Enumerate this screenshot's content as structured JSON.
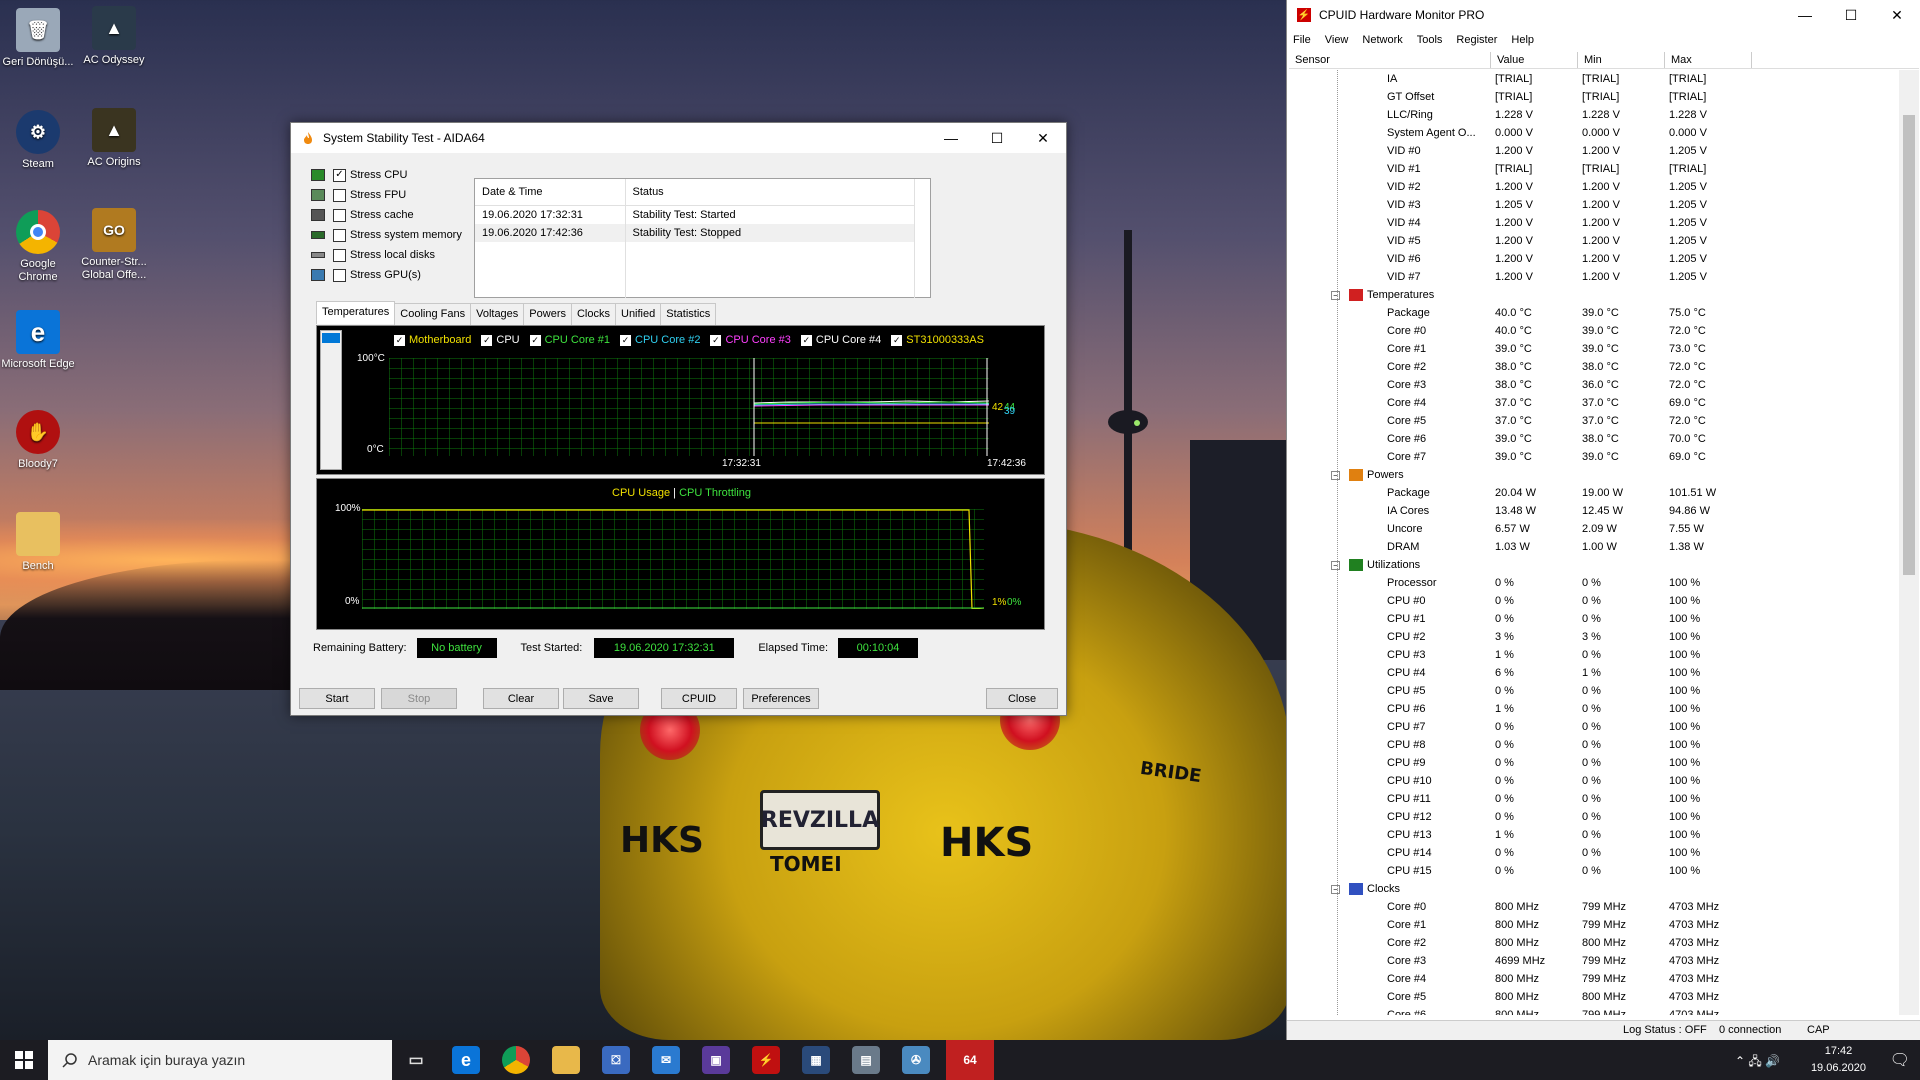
{
  "desktop": {
    "icons": [
      {
        "label": "Geri Dönüşü...",
        "icon": "recycle-bin-icon",
        "color": "#9aa8b8"
      },
      {
        "label": "AC Odyssey",
        "icon": "ac-odyssey-icon",
        "color": "#2a3a4a"
      },
      {
        "label": "Steam",
        "icon": "steam-icon",
        "color": "#1b3a6e"
      },
      {
        "label": "AC Origins",
        "icon": "ac-origins-icon",
        "color": "#3a3420"
      },
      {
        "label": "Google Chrome",
        "icon": "chrome-icon",
        "color": "#db4437"
      },
      {
        "label": "Counter-Str... Global Offe...",
        "icon": "csgo-icon",
        "color": "#b07a20"
      },
      {
        "label": "Microsoft Edge",
        "icon": "edge-icon",
        "color": "#0a74d8"
      },
      {
        "label": "Bloody7",
        "icon": "bloody7-icon",
        "color": "#b01010"
      },
      {
        "label": "Bench",
        "icon": "folder-icon",
        "color": "#e8c060"
      }
    ]
  },
  "aida": {
    "title": "System Stability Test - AIDA64",
    "stress": [
      {
        "label": "Stress CPU",
        "checked": "✓"
      },
      {
        "label": "Stress FPU",
        "checked": ""
      },
      {
        "label": "Stress cache",
        "checked": ""
      },
      {
        "label": "Stress system memory",
        "checked": ""
      },
      {
        "label": "Stress local disks",
        "checked": ""
      },
      {
        "label": "Stress GPU(s)",
        "checked": ""
      }
    ],
    "log": {
      "headers": [
        "Date & Time",
        "Status"
      ],
      "rows": [
        [
          "19.06.2020 17:32:31",
          "Stability Test: Started"
        ],
        [
          "19.06.2020 17:42:36",
          "Stability Test: Stopped"
        ]
      ]
    },
    "tabs": [
      "Temperatures",
      "Cooling Fans",
      "Voltages",
      "Powers",
      "Clocks",
      "Unified",
      "Statistics"
    ],
    "temp_graph": {
      "legend": [
        {
          "label": "Motherboard",
          "color": "#f0e000"
        },
        {
          "label": "CPU",
          "color": "#ffffff"
        },
        {
          "label": "CPU Core #1",
          "color": "#3ee23e"
        },
        {
          "label": "CPU Core #2",
          "color": "#30d0f0"
        },
        {
          "label": "CPU Core #3",
          "color": "#ff40ff"
        },
        {
          "label": "CPU Core #4",
          "color": "#ffffff"
        },
        {
          "label": "ST31000333AS",
          "color": "#f0e000"
        }
      ],
      "y_top": "100",
      "y_top_unit": "°C",
      "y_bottom": "0",
      "y_bottom_unit": "°C",
      "t_start": "17:32:31",
      "t_end": "17:42:36",
      "end_values_a": "42",
      "end_values_b": "44",
      "end_values_c": "39"
    },
    "cpu_graph": {
      "title_usage": "CPU Usage",
      "separator": "|",
      "title_throttle": "CPU Throttling",
      "y_top": "100%",
      "y_bottom": "0%",
      "end_usage": "1%",
      "end_throttle": "0%"
    },
    "info": {
      "battery_label": "Remaining Battery:",
      "battery_value": "No battery",
      "started_label": "Test Started:",
      "started_value": "19.06.2020 17:32:31",
      "elapsed_label": "Elapsed Time:",
      "elapsed_value": "00:10:04"
    },
    "buttons": {
      "start": "Start",
      "stop": "Stop",
      "clear": "Clear",
      "save": "Save",
      "cpuid": "CPUID",
      "preferences": "Preferences",
      "close": "Close"
    }
  },
  "hwm": {
    "title": "CPUID Hardware Monitor PRO",
    "menu": [
      "File",
      "View",
      "Network",
      "Tools",
      "Register",
      "Help"
    ],
    "columns": [
      "Sensor",
      "Value",
      "Min",
      "Max"
    ],
    "rows": [
      {
        "type": "item",
        "n": "IA",
        "v": "[TRIAL]",
        "mi": "[TRIAL]",
        "ma": "[TRIAL]"
      },
      {
        "type": "item",
        "n": "GT Offset",
        "v": "[TRIAL]",
        "mi": "[TRIAL]",
        "ma": "[TRIAL]"
      },
      {
        "type": "item",
        "n": "LLC/Ring",
        "v": "1.228 V",
        "mi": "1.228 V",
        "ma": "1.228 V"
      },
      {
        "type": "item",
        "n": "System Agent O...",
        "v": "0.000 V",
        "mi": "0.000 V",
        "ma": "0.000 V"
      },
      {
        "type": "item",
        "n": "VID #0",
        "v": "1.200 V",
        "mi": "1.200 V",
        "ma": "1.205 V"
      },
      {
        "type": "item",
        "n": "VID #1",
        "v": "[TRIAL]",
        "mi": "[TRIAL]",
        "ma": "[TRIAL]"
      },
      {
        "type": "item",
        "n": "VID #2",
        "v": "1.200 V",
        "mi": "1.200 V",
        "ma": "1.205 V"
      },
      {
        "type": "item",
        "n": "VID #3",
        "v": "1.205 V",
        "mi": "1.200 V",
        "ma": "1.205 V"
      },
      {
        "type": "item",
        "n": "VID #4",
        "v": "1.200 V",
        "mi": "1.200 V",
        "ma": "1.205 V"
      },
      {
        "type": "item",
        "n": "VID #5",
        "v": "1.200 V",
        "mi": "1.200 V",
        "ma": "1.205 V"
      },
      {
        "type": "item",
        "n": "VID #6",
        "v": "1.200 V",
        "mi": "1.200 V",
        "ma": "1.205 V"
      },
      {
        "type": "item",
        "n": "VID #7",
        "v": "1.200 V",
        "mi": "1.200 V",
        "ma": "1.205 V"
      },
      {
        "type": "group",
        "n": "Temperatures",
        "icon": "thermometer-icon",
        "color": "#d02020"
      },
      {
        "type": "item",
        "n": "Package",
        "v": "40.0 °C",
        "mi": "39.0 °C",
        "ma": "75.0 °C"
      },
      {
        "type": "item",
        "n": "Core #0",
        "v": "40.0 °C",
        "mi": "39.0 °C",
        "ma": "72.0 °C"
      },
      {
        "type": "item",
        "n": "Core #1",
        "v": "39.0 °C",
        "mi": "39.0 °C",
        "ma": "73.0 °C"
      },
      {
        "type": "item",
        "n": "Core #2",
        "v": "38.0 °C",
        "mi": "38.0 °C",
        "ma": "72.0 °C"
      },
      {
        "type": "item",
        "n": "Core #3",
        "v": "38.0 °C",
        "mi": "36.0 °C",
        "ma": "72.0 °C"
      },
      {
        "type": "item",
        "n": "Core #4",
        "v": "37.0 °C",
        "mi": "37.0 °C",
        "ma": "69.0 °C"
      },
      {
        "type": "item",
        "n": "Core #5",
        "v": "37.0 °C",
        "mi": "37.0 °C",
        "ma": "72.0 °C"
      },
      {
        "type": "item",
        "n": "Core #6",
        "v": "39.0 °C",
        "mi": "38.0 °C",
        "ma": "70.0 °C"
      },
      {
        "type": "item",
        "n": "Core #7",
        "v": "39.0 °C",
        "mi": "39.0 °C",
        "ma": "69.0 °C"
      },
      {
        "type": "group",
        "n": "Powers",
        "icon": "power-icon",
        "color": "#e08010"
      },
      {
        "type": "item",
        "n": "Package",
        "v": "20.04 W",
        "mi": "19.00 W",
        "ma": "101.51 W"
      },
      {
        "type": "item",
        "n": "IA Cores",
        "v": "13.48 W",
        "mi": "12.45 W",
        "ma": "94.86 W"
      },
      {
        "type": "item",
        "n": "Uncore",
        "v": "6.57 W",
        "mi": "2.09 W",
        "ma": "7.55 W"
      },
      {
        "type": "item",
        "n": "DRAM",
        "v": "1.03 W",
        "mi": "1.00 W",
        "ma": "1.38 W"
      },
      {
        "type": "group",
        "n": "Utilizations",
        "icon": "utilization-icon",
        "color": "#208020"
      },
      {
        "type": "item",
        "n": "Processor",
        "v": "0 %",
        "mi": "0 %",
        "ma": "100 %"
      },
      {
        "type": "item",
        "n": "CPU #0",
        "v": "0 %",
        "mi": "0 %",
        "ma": "100 %"
      },
      {
        "type": "item",
        "n": "CPU #1",
        "v": "0 %",
        "mi": "0 %",
        "ma": "100 %"
      },
      {
        "type": "item",
        "n": "CPU #2",
        "v": "3 %",
        "mi": "3 %",
        "ma": "100 %"
      },
      {
        "type": "item",
        "n": "CPU #3",
        "v": "1 %",
        "mi": "0 %",
        "ma": "100 %"
      },
      {
        "type": "item",
        "n": "CPU #4",
        "v": "6 %",
        "mi": "1 %",
        "ma": "100 %"
      },
      {
        "type": "item",
        "n": "CPU #5",
        "v": "0 %",
        "mi": "0 %",
        "ma": "100 %"
      },
      {
        "type": "item",
        "n": "CPU #6",
        "v": "1 %",
        "mi": "0 %",
        "ma": "100 %"
      },
      {
        "type": "item",
        "n": "CPU #7",
        "v": "0 %",
        "mi": "0 %",
        "ma": "100 %"
      },
      {
        "type": "item",
        "n": "CPU #8",
        "v": "0 %",
        "mi": "0 %",
        "ma": "100 %"
      },
      {
        "type": "item",
        "n": "CPU #9",
        "v": "0 %",
        "mi": "0 %",
        "ma": "100 %"
      },
      {
        "type": "item",
        "n": "CPU #10",
        "v": "0 %",
        "mi": "0 %",
        "ma": "100 %"
      },
      {
        "type": "item",
        "n": "CPU #11",
        "v": "0 %",
        "mi": "0 %",
        "ma": "100 %"
      },
      {
        "type": "item",
        "n": "CPU #12",
        "v": "0 %",
        "mi": "0 %",
        "ma": "100 %"
      },
      {
        "type": "item",
        "n": "CPU #13",
        "v": "1 %",
        "mi": "0 %",
        "ma": "100 %"
      },
      {
        "type": "item",
        "n": "CPU #14",
        "v": "0 %",
        "mi": "0 %",
        "ma": "100 %"
      },
      {
        "type": "item",
        "n": "CPU #15",
        "v": "0 %",
        "mi": "0 %",
        "ma": "100 %"
      },
      {
        "type": "group",
        "n": "Clocks",
        "icon": "clock-icon",
        "color": "#3050c0"
      },
      {
        "type": "item",
        "n": "Core #0",
        "v": "800 MHz",
        "mi": "799 MHz",
        "ma": "4703 MHz"
      },
      {
        "type": "item",
        "n": "Core #1",
        "v": "800 MHz",
        "mi": "799 MHz",
        "ma": "4703 MHz"
      },
      {
        "type": "item",
        "n": "Core #2",
        "v": "800 MHz",
        "mi": "800 MHz",
        "ma": "4703 MHz"
      },
      {
        "type": "item",
        "n": "Core #3",
        "v": "4699 MHz",
        "mi": "799 MHz",
        "ma": "4703 MHz"
      },
      {
        "type": "item",
        "n": "Core #4",
        "v": "800 MHz",
        "mi": "799 MHz",
        "ma": "4703 MHz"
      },
      {
        "type": "item",
        "n": "Core #5",
        "v": "800 MHz",
        "mi": "800 MHz",
        "ma": "4703 MHz"
      },
      {
        "type": "item",
        "n": "Core #6",
        "v": "800 MHz",
        "mi": "799 MHz",
        "ma": "4703 MHz"
      }
    ],
    "status": {
      "log": "Log Status : OFF",
      "conn": "0 connection",
      "cap": "CAP"
    }
  },
  "taskbar": {
    "search_placeholder": "Aramak için buraya yazın",
    "time": "17:42",
    "date": "19.06.2020",
    "aida_icon_text": "64"
  },
  "car": {
    "plate": "REVZILLA",
    "brand_hks": "HKS",
    "brand_tomei": "TOMEI",
    "brand_bride": "BRIDE"
  }
}
